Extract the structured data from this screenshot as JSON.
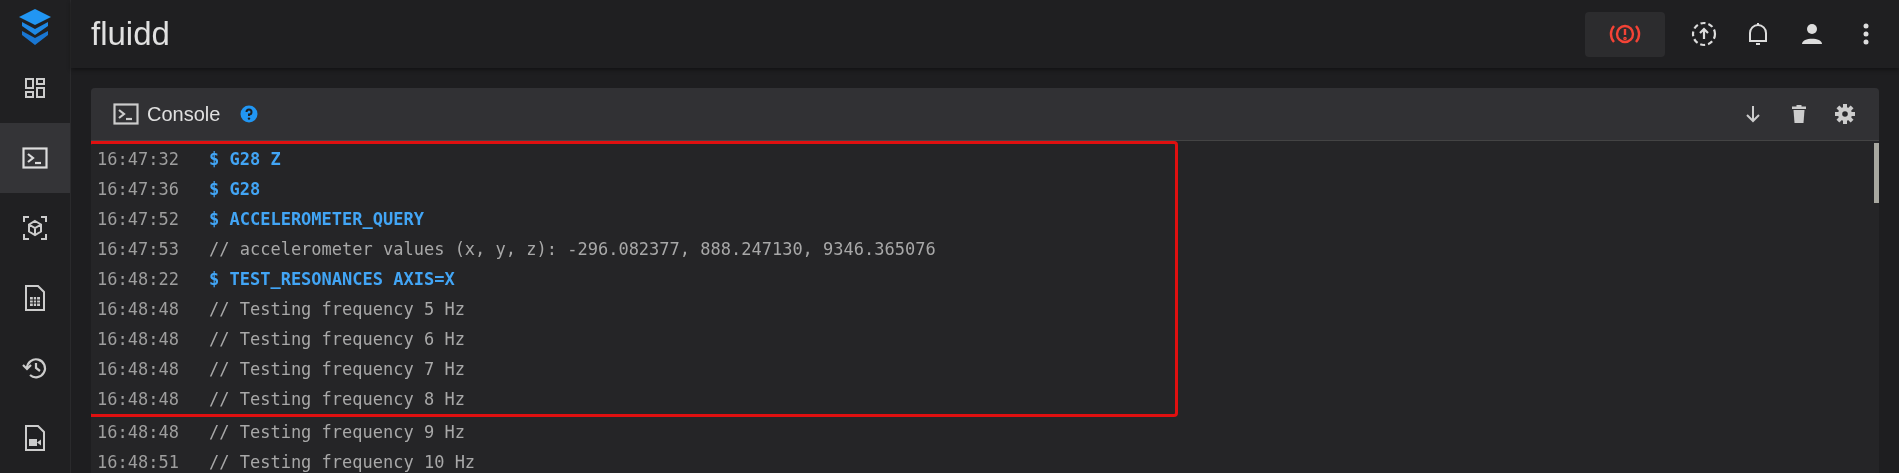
{
  "app": {
    "title": "fluidd"
  },
  "sidebar": {
    "items": [
      {
        "selected": false
      },
      {
        "selected": true
      },
      {
        "selected": false
      },
      {
        "selected": false
      },
      {
        "selected": false
      },
      {
        "selected": false
      }
    ]
  },
  "console": {
    "title": "Console",
    "highlighted_lines": [
      {
        "time": "16:47:32",
        "kind": "command",
        "text": "$ G28 Z"
      },
      {
        "time": "16:47:36",
        "kind": "command",
        "text": "$ G28"
      },
      {
        "time": "16:47:52",
        "kind": "command",
        "text": "$ ACCELEROMETER_QUERY"
      },
      {
        "time": "16:47:53",
        "kind": "response",
        "text": "// accelerometer values (x, y, z): -296.082377, 888.247130, 9346.365076"
      },
      {
        "time": "16:48:22",
        "kind": "command",
        "text": "$ TEST_RESONANCES AXIS=X"
      },
      {
        "time": "16:48:48",
        "kind": "response",
        "text": "// Testing frequency 5 Hz"
      },
      {
        "time": "16:48:48",
        "kind": "response",
        "text": "// Testing frequency 6 Hz"
      },
      {
        "time": "16:48:48",
        "kind": "response",
        "text": "// Testing frequency 7 Hz"
      },
      {
        "time": "16:48:48",
        "kind": "response",
        "text": "// Testing frequency 8 Hz"
      }
    ],
    "lines": [
      {
        "time": "16:48:48",
        "kind": "response",
        "text": "// Testing frequency 9 Hz"
      },
      {
        "time": "16:48:51",
        "kind": "response",
        "text": "// Testing frequency 10 Hz"
      }
    ]
  }
}
